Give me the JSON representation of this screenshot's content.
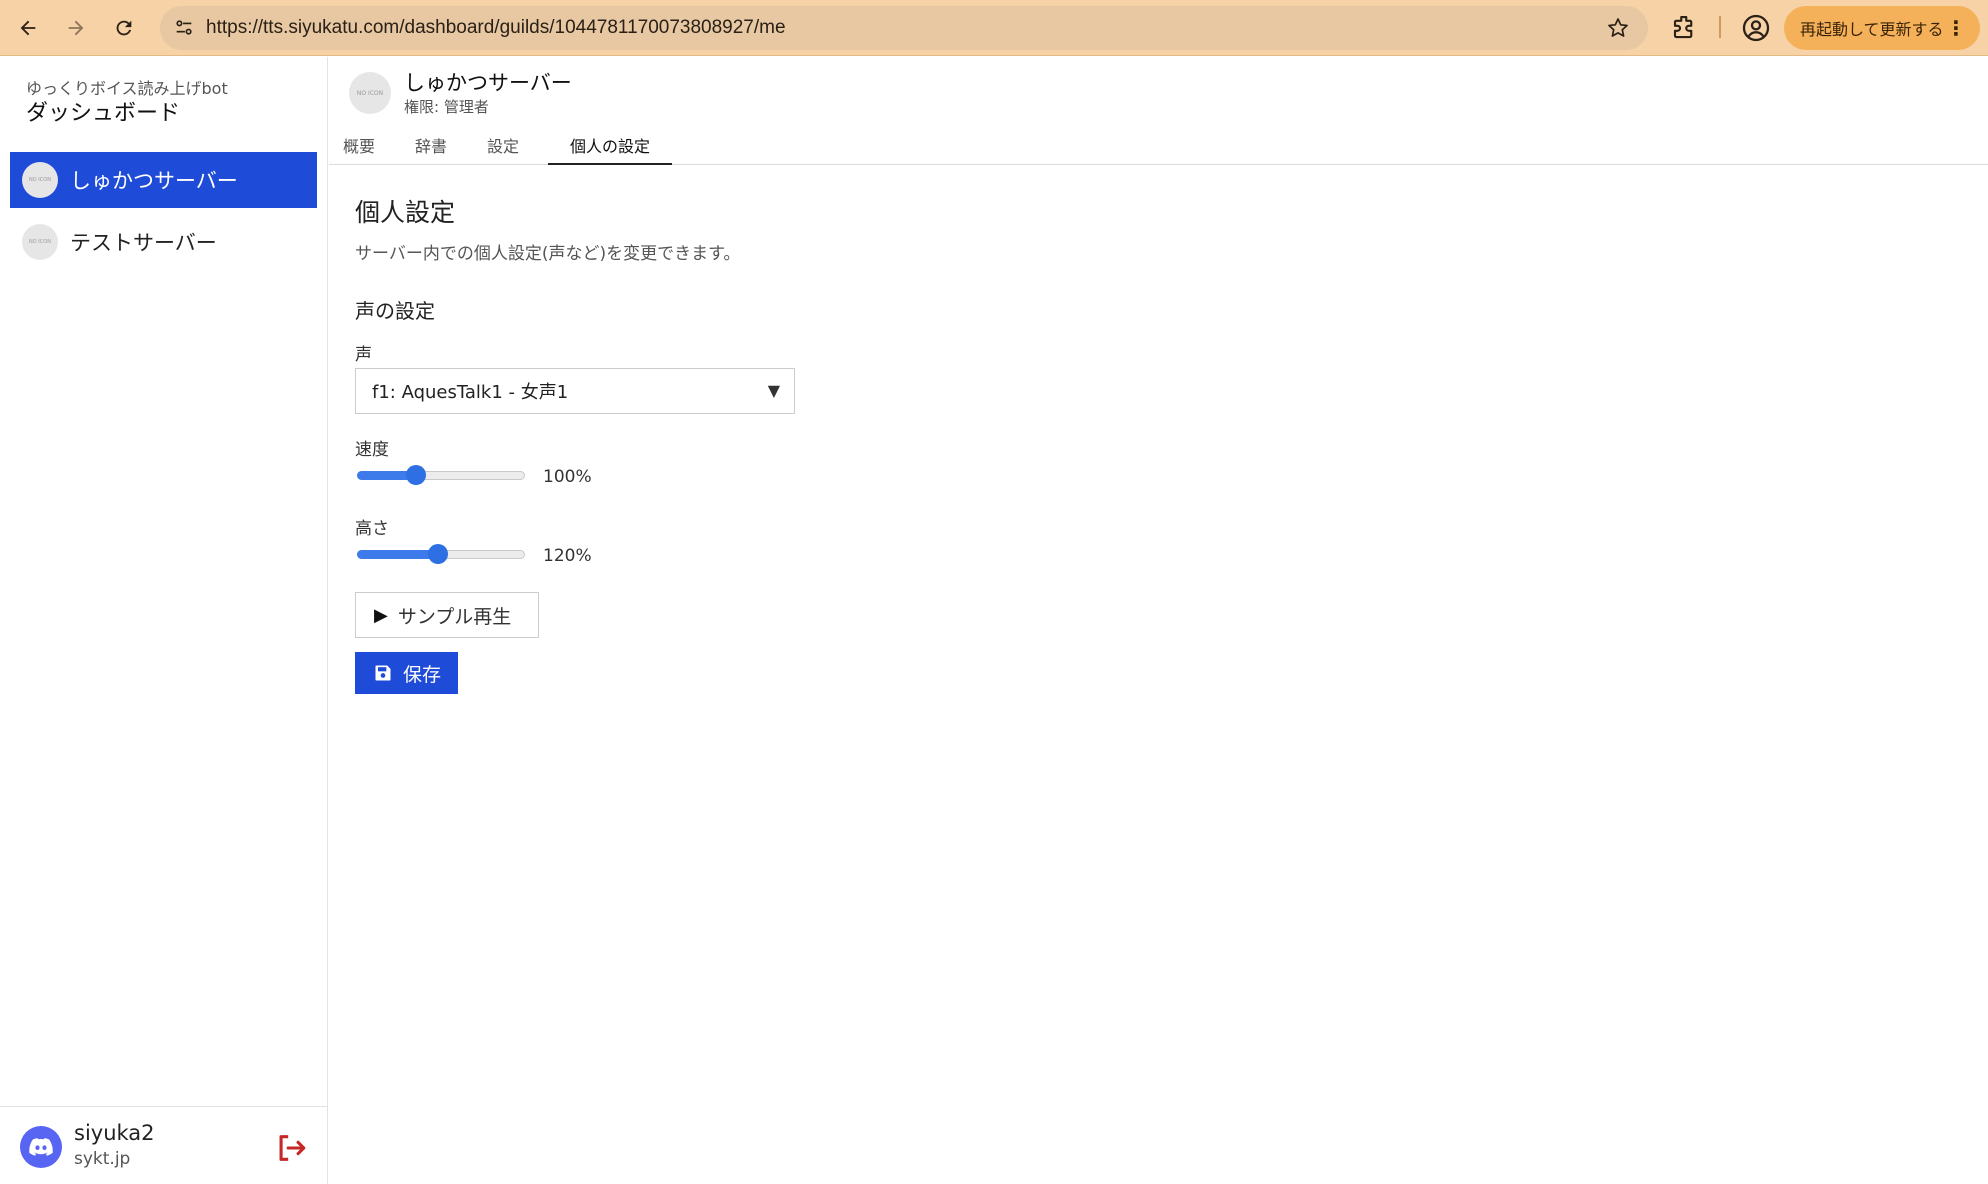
{
  "browser": {
    "url": "https://tts.siyukatu.com/dashboard/guilds/1044781170073808927/me",
    "update_label": "再起動して更新する"
  },
  "sidebar": {
    "subtitle": "ゆっくりボイス読み上げbot",
    "title": "ダッシュボード",
    "no_icon_text": "NO ICON",
    "items": [
      {
        "label": "しゅかつサーバー",
        "active": true
      },
      {
        "label": "テストサーバー",
        "active": false
      }
    ],
    "user": {
      "name": "siyuka2",
      "sub": "sykt.jp"
    }
  },
  "guild": {
    "name": "しゅかつサーバー",
    "role": "権限: 管理者"
  },
  "tabs": [
    {
      "label": "概要"
    },
    {
      "label": "辞書"
    },
    {
      "label": "設定"
    },
    {
      "label": "個人の設定",
      "active": true
    }
  ],
  "settings": {
    "title": "個人設定",
    "description": "サーバー内での個人設定(声など)を変更できます。",
    "voice_section_title": "声の設定",
    "voice_label": "声",
    "voice_selected": "f1: AquesTalk1 - 女声1",
    "speed_label": "速度",
    "speed_value": "100%",
    "speed_fraction": 0.35,
    "pitch_label": "高さ",
    "pitch_value": "120%",
    "pitch_fraction": 0.48,
    "sample_label": "サンプル再生",
    "save_label": "保存"
  },
  "colors": {
    "accent": "#1e4bd8",
    "slider": "#2f6fe4",
    "discord": "#5865f2",
    "logout": "#c62828"
  }
}
